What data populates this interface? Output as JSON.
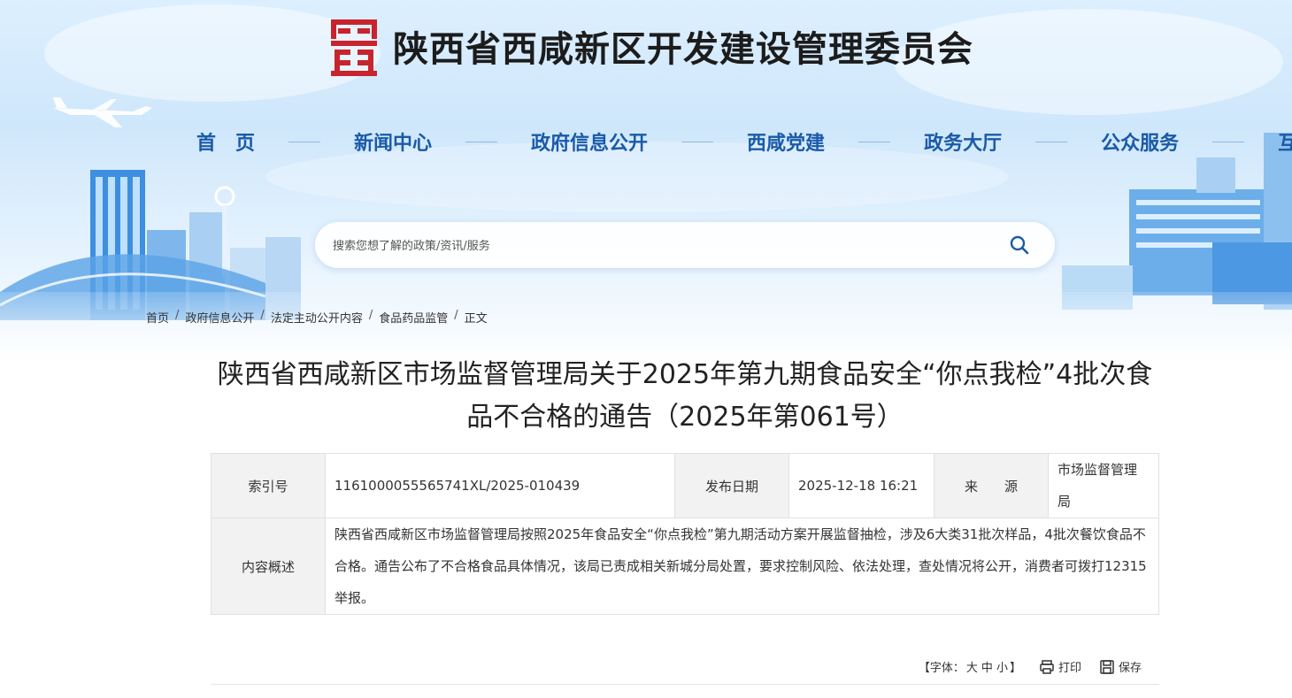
{
  "site": {
    "title": "陕西省西咸新区开发建设管理委员会"
  },
  "nav": [
    {
      "label": "首　页"
    },
    {
      "label": "新闻中心"
    },
    {
      "label": "政府信息公开"
    },
    {
      "label": "西咸党建"
    },
    {
      "label": "政务大厅"
    },
    {
      "label": "公众服务"
    },
    {
      "label": "互动交流"
    }
  ],
  "search": {
    "placeholder": "搜索您想了解的政策/资讯/服务",
    "icon": "search-icon"
  },
  "breadcrumb": [
    {
      "label": "首页"
    },
    {
      "label": "政府信息公开"
    },
    {
      "label": "法定主动公开内容"
    },
    {
      "label": "食品药品监管"
    },
    {
      "label": "正文"
    }
  ],
  "article": {
    "title": "陕西省西咸新区市场监督管理局关于2025年第九期食品安全“你点我检”4批次食品不合格的通告（2025年第061号）"
  },
  "meta": {
    "index_label": "索引号",
    "index_value": "1161000055565741XL/2025-010439",
    "date_label": "发布日期",
    "date_value": "2025-12-18 16:21",
    "source_label": "来　　源",
    "source_value": "市场监督管理局",
    "summary_label": "内容概述",
    "summary_value": "陕西省西咸新区市场监督管理局按照2025年食品安全“你点我检”第九期活动方案开展监督抽检，涉及6大类31批次样品，4批次餐饮食品不合格。通告公布了不合格食品具体情况，该局已责成相关新城分局处置，要求控制风险、依法处理，查处情况将公开，消费者可拨打12315举报。"
  },
  "tools": {
    "font_prefix": "【字体：",
    "size_large": "大",
    "size_medium": "中",
    "size_small": "小",
    "font_suffix": "】",
    "print_label": "打印",
    "save_label": "保存"
  },
  "colors": {
    "nav": "#1a5aa8",
    "seal": "#c8242e",
    "title": "#1c1c1c"
  }
}
